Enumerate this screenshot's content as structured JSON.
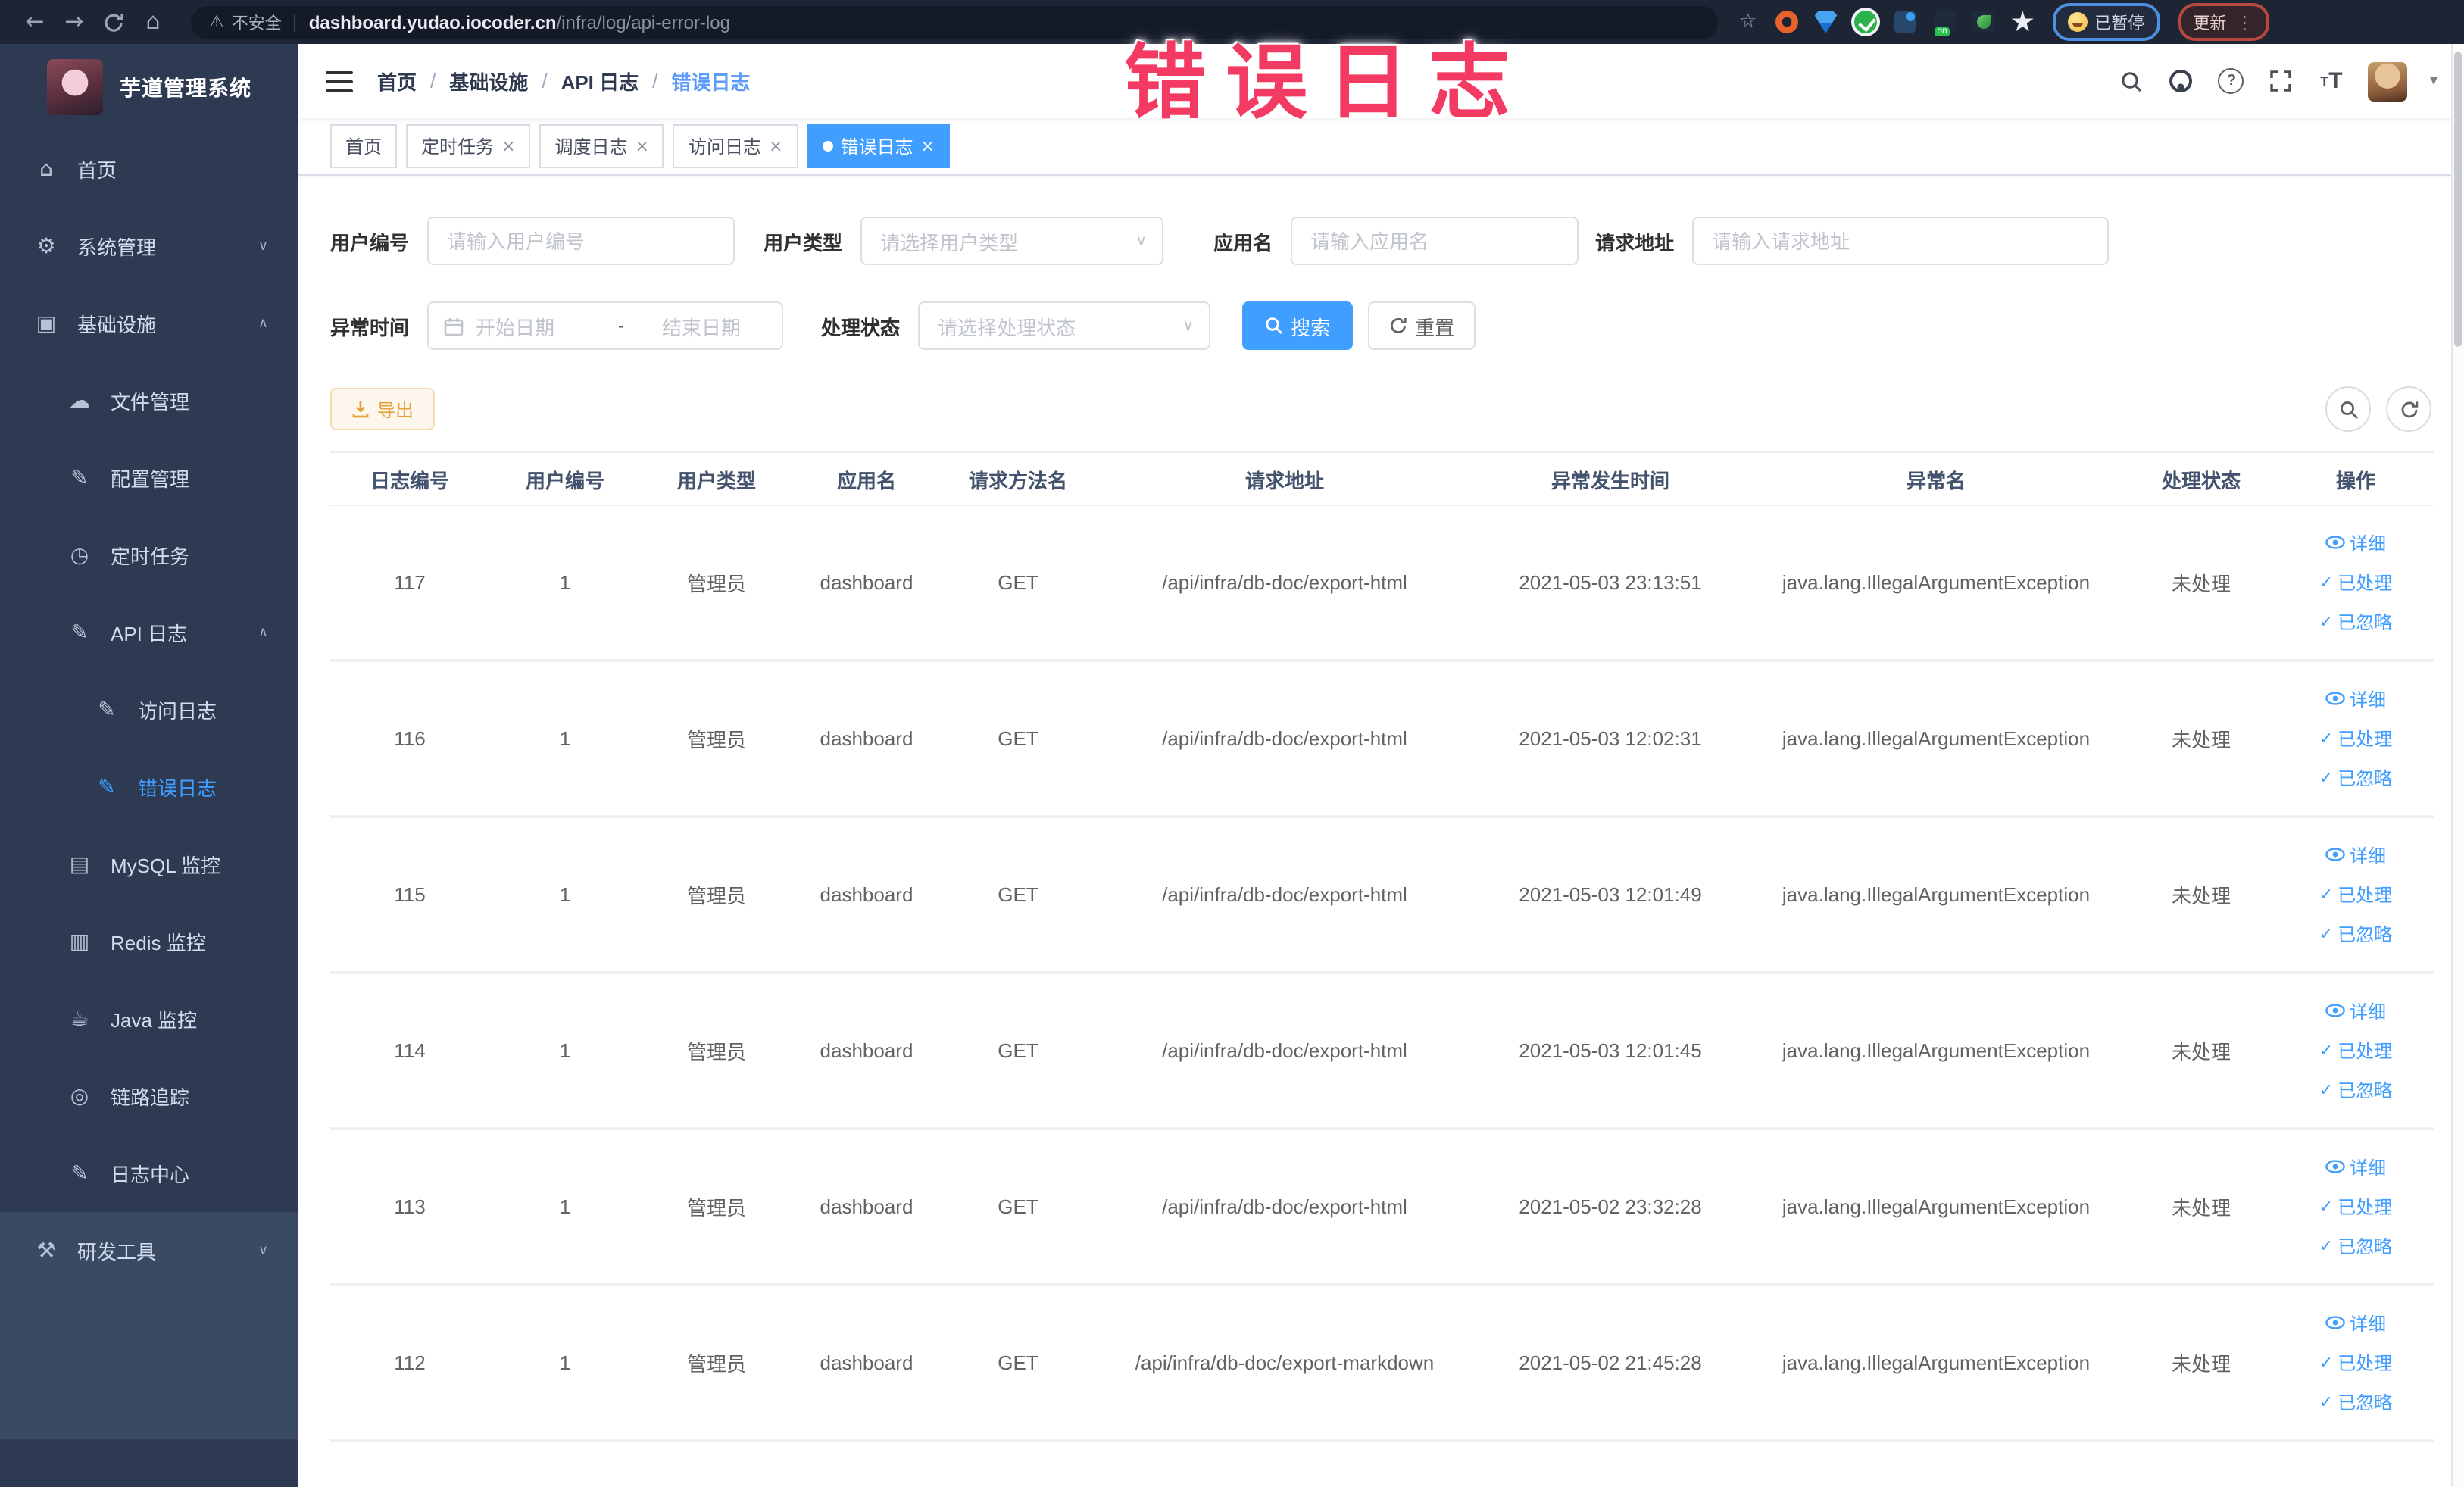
{
  "overlay": {
    "title": "错误日志"
  },
  "browser": {
    "security_label": "不安全",
    "url_domain": "dashboard.yudao.iocoder.cn",
    "url_path": "/infra/log/api-error-log",
    "paused_label": "已暂停",
    "update_label": "更新"
  },
  "icons": {
    "back": "←",
    "forward": "→",
    "home": "⌂",
    "warning": "⚠",
    "star": "☆",
    "dots": "⋮",
    "caret_down": "▾",
    "question": "?",
    "font_large": "T",
    "font_small": "T",
    "chev_down": "∨",
    "chev_up": "∧",
    "check": "✓",
    "close": "×",
    "crumb_sep": "/",
    "range_sep": "-",
    "select_caret": "∨",
    "homeg": "⌂",
    "gear": "⚙",
    "infra": "▣",
    "cloud": "☁",
    "edit": "✎",
    "clock": "◷",
    "apilog": "✎",
    "doc": "✎",
    "mysql": "▤",
    "redis": "▥",
    "java": "☕",
    "trace": "◎",
    "logcenter": "✎",
    "tools": "⚒"
  },
  "sidebar": {
    "app_title": "芋道管理系统",
    "items": [
      {
        "label": "首页",
        "icon": "homeg",
        "indent": 1
      },
      {
        "label": "系统管理",
        "icon": "gear",
        "indent": 1,
        "chevron": "down"
      },
      {
        "label": "基础设施",
        "icon": "infra",
        "indent": 1,
        "chevron": "up"
      },
      {
        "label": "文件管理",
        "icon": "cloud",
        "indent": 2
      },
      {
        "label": "配置管理",
        "icon": "edit",
        "indent": 2
      },
      {
        "label": "定时任务",
        "icon": "clock",
        "indent": 2
      },
      {
        "label": "API 日志",
        "icon": "apilog",
        "indent": 2,
        "chevron": "up"
      },
      {
        "label": "访问日志",
        "icon": "doc",
        "indent": 3
      },
      {
        "label": "错误日志",
        "icon": "doc",
        "indent": 3,
        "active": true
      },
      {
        "label": "MySQL 监控",
        "icon": "mysql",
        "indent": 2
      },
      {
        "label": "Redis 监控",
        "icon": "redis",
        "indent": 2
      },
      {
        "label": "Java 监控",
        "icon": "java",
        "indent": 2
      },
      {
        "label": "链路追踪",
        "icon": "trace",
        "indent": 2
      },
      {
        "label": "日志中心",
        "icon": "logcenter",
        "indent": 2
      },
      {
        "label": "研发工具",
        "icon": "tools",
        "indent": 1,
        "chevron": "down",
        "section": true
      }
    ]
  },
  "header": {
    "breadcrumb": [
      "首页",
      "基础设施",
      "API 日志",
      "错误日志"
    ]
  },
  "tabs": [
    {
      "label": "首页",
      "closable": false,
      "active": false
    },
    {
      "label": "定时任务",
      "closable": true,
      "active": false
    },
    {
      "label": "调度日志",
      "closable": true,
      "active": false
    },
    {
      "label": "访问日志",
      "closable": true,
      "active": false
    },
    {
      "label": "错误日志",
      "closable": true,
      "active": true
    }
  ],
  "filters": {
    "user_id_label": "用户编号",
    "user_id_placeholder": "请输入用户编号",
    "user_type_label": "用户类型",
    "user_type_placeholder": "请选择用户类型",
    "app_name_label": "应用名",
    "app_name_placeholder": "请输入应用名",
    "request_url_label": "请求地址",
    "request_url_placeholder": "请输入请求地址",
    "exception_time_label": "异常时间",
    "start_date_placeholder": "开始日期",
    "end_date_placeholder": "结束日期",
    "process_status_label": "处理状态",
    "process_status_placeholder": "请选择处理状态",
    "search_label": "搜索",
    "reset_label": "重置"
  },
  "toolbar": {
    "export_label": "导出"
  },
  "table": {
    "columns": [
      "日志编号",
      "用户编号",
      "用户类型",
      "应用名",
      "请求方法名",
      "请求地址",
      "异常发生时间",
      "异常名",
      "处理状态",
      "操作"
    ],
    "actions": [
      {
        "label": "详细",
        "icon": "eye"
      },
      {
        "label": "已处理",
        "icon": "check"
      },
      {
        "label": "已忽略",
        "icon": "check"
      }
    ],
    "rows": [
      {
        "id": "117",
        "user_id": "1",
        "user_type": "管理员",
        "app": "dashboard",
        "method": "GET",
        "url": "/api/infra/db-doc/export-html",
        "time": "2021-05-03 23:13:51",
        "exception": "java.lang.IllegalArgumentException",
        "status": "未处理"
      },
      {
        "id": "116",
        "user_id": "1",
        "user_type": "管理员",
        "app": "dashboard",
        "method": "GET",
        "url": "/api/infra/db-doc/export-html",
        "time": "2021-05-03 12:02:31",
        "exception": "java.lang.IllegalArgumentException",
        "status": "未处理"
      },
      {
        "id": "115",
        "user_id": "1",
        "user_type": "管理员",
        "app": "dashboard",
        "method": "GET",
        "url": "/api/infra/db-doc/export-html",
        "time": "2021-05-03 12:01:49",
        "exception": "java.lang.IllegalArgumentException",
        "status": "未处理"
      },
      {
        "id": "114",
        "user_id": "1",
        "user_type": "管理员",
        "app": "dashboard",
        "method": "GET",
        "url": "/api/infra/db-doc/export-html",
        "time": "2021-05-03 12:01:45",
        "exception": "java.lang.IllegalArgumentException",
        "status": "未处理"
      },
      {
        "id": "113",
        "user_id": "1",
        "user_type": "管理员",
        "app": "dashboard",
        "method": "GET",
        "url": "/api/infra/db-doc/export-html",
        "time": "2021-05-02 23:32:28",
        "exception": "java.lang.IllegalArgumentException",
        "status": "未处理"
      },
      {
        "id": "112",
        "user_id": "1",
        "user_type": "管理员",
        "app": "dashboard",
        "method": "GET",
        "url": "/api/infra/db-doc/export-markdown",
        "time": "2021-05-02 21:45:28",
        "exception": "java.lang.IllegalArgumentException",
        "status": "未处理"
      }
    ]
  },
  "colors": {
    "accent": "#409eff",
    "sidebar_bg": "#2d3a52",
    "browser_bar_bg": "#1d2534",
    "export_text": "#e6a23c",
    "overlay_pink": "#f23a62"
  }
}
